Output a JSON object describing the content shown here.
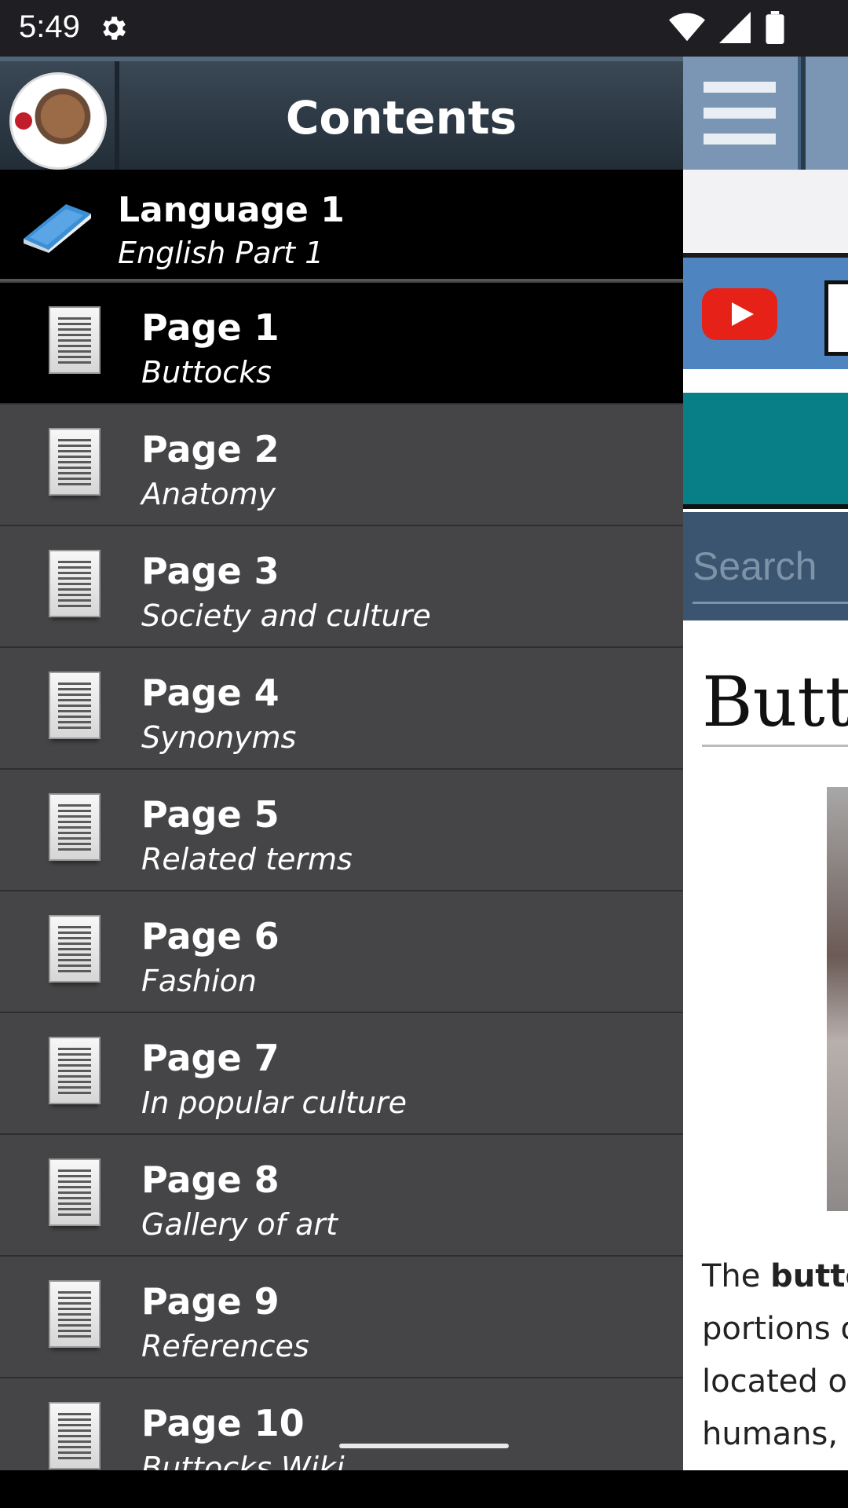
{
  "status_bar": {
    "time": "5:49"
  },
  "drawer": {
    "title": "Contents",
    "group": {
      "title": "Language 1",
      "subtitle": "English Part 1"
    },
    "items": [
      {
        "title": "Page 1",
        "subtitle": "Buttocks"
      },
      {
        "title": "Page 2",
        "subtitle": "Anatomy"
      },
      {
        "title": "Page 3",
        "subtitle": "Society and culture"
      },
      {
        "title": "Page 4",
        "subtitle": "Synonyms"
      },
      {
        "title": "Page 5",
        "subtitle": "Related terms"
      },
      {
        "title": "Page 6",
        "subtitle": "Fashion"
      },
      {
        "title": "Page 7",
        "subtitle": "In popular culture"
      },
      {
        "title": "Page 8",
        "subtitle": "Gallery of art"
      },
      {
        "title": "Page 9",
        "subtitle": "References"
      },
      {
        "title": "Page 10",
        "subtitle": "Buttocks Wiki"
      }
    ]
  },
  "content": {
    "search_placeholder": "Search",
    "article_title": "Buttocks",
    "para_line1_prefix": "The ",
    "para_line1_bold": "buttocks",
    "para_line2": "portions of",
    "para_line3": "located on",
    "para_line4": "humans, the"
  },
  "colors": {
    "drawer_bg": "#454547",
    "active_item_bg": "#000000",
    "toolbar_blue": "#3f5f80",
    "teal": "#087f86",
    "youtube_red": "#e62117"
  }
}
